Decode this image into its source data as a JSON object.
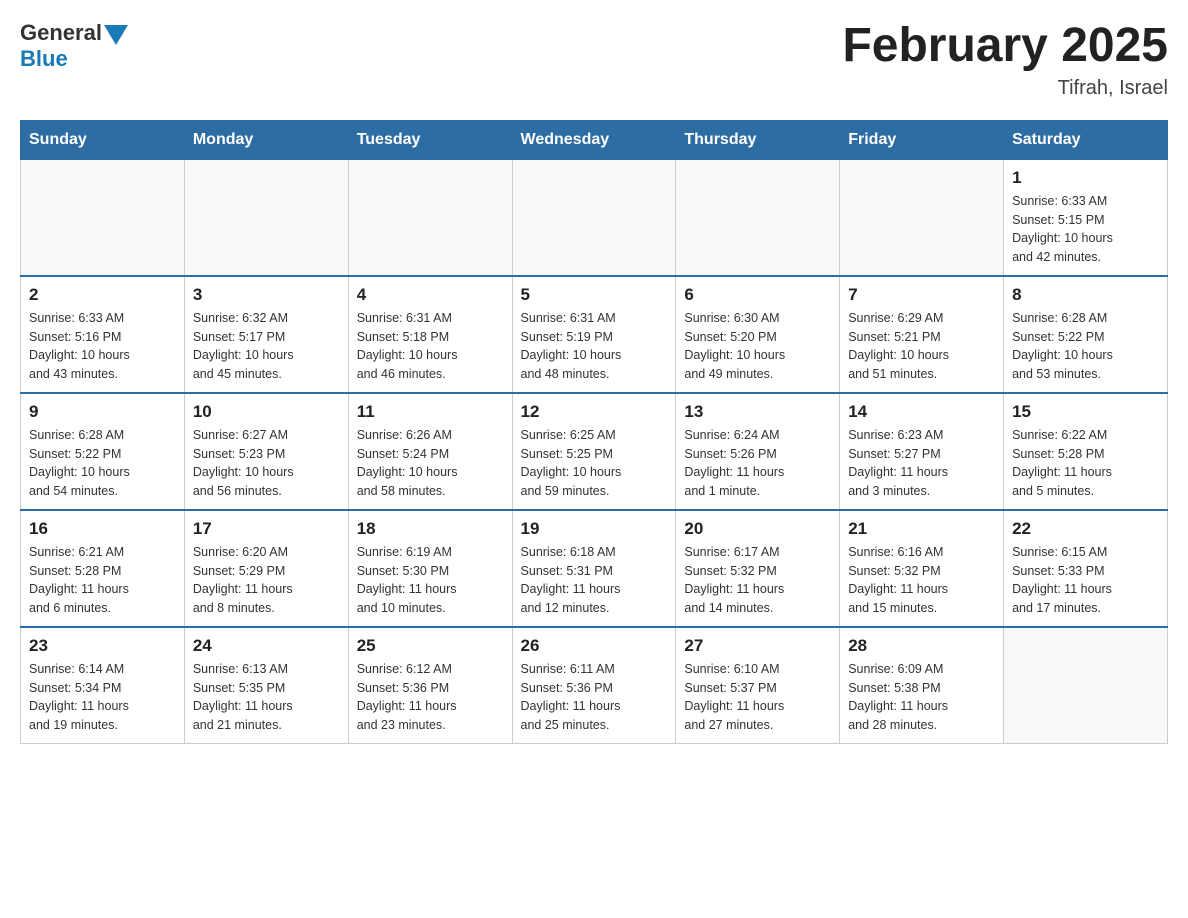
{
  "header": {
    "logo_general": "General",
    "logo_blue": "Blue",
    "title": "February 2025",
    "subtitle": "Tifrah, Israel"
  },
  "weekdays": [
    "Sunday",
    "Monday",
    "Tuesday",
    "Wednesday",
    "Thursday",
    "Friday",
    "Saturday"
  ],
  "weeks": [
    [
      {
        "day": "",
        "info": ""
      },
      {
        "day": "",
        "info": ""
      },
      {
        "day": "",
        "info": ""
      },
      {
        "day": "",
        "info": ""
      },
      {
        "day": "",
        "info": ""
      },
      {
        "day": "",
        "info": ""
      },
      {
        "day": "1",
        "info": "Sunrise: 6:33 AM\nSunset: 5:15 PM\nDaylight: 10 hours\nand 42 minutes."
      }
    ],
    [
      {
        "day": "2",
        "info": "Sunrise: 6:33 AM\nSunset: 5:16 PM\nDaylight: 10 hours\nand 43 minutes."
      },
      {
        "day": "3",
        "info": "Sunrise: 6:32 AM\nSunset: 5:17 PM\nDaylight: 10 hours\nand 45 minutes."
      },
      {
        "day": "4",
        "info": "Sunrise: 6:31 AM\nSunset: 5:18 PM\nDaylight: 10 hours\nand 46 minutes."
      },
      {
        "day": "5",
        "info": "Sunrise: 6:31 AM\nSunset: 5:19 PM\nDaylight: 10 hours\nand 48 minutes."
      },
      {
        "day": "6",
        "info": "Sunrise: 6:30 AM\nSunset: 5:20 PM\nDaylight: 10 hours\nand 49 minutes."
      },
      {
        "day": "7",
        "info": "Sunrise: 6:29 AM\nSunset: 5:21 PM\nDaylight: 10 hours\nand 51 minutes."
      },
      {
        "day": "8",
        "info": "Sunrise: 6:28 AM\nSunset: 5:22 PM\nDaylight: 10 hours\nand 53 minutes."
      }
    ],
    [
      {
        "day": "9",
        "info": "Sunrise: 6:28 AM\nSunset: 5:22 PM\nDaylight: 10 hours\nand 54 minutes."
      },
      {
        "day": "10",
        "info": "Sunrise: 6:27 AM\nSunset: 5:23 PM\nDaylight: 10 hours\nand 56 minutes."
      },
      {
        "day": "11",
        "info": "Sunrise: 6:26 AM\nSunset: 5:24 PM\nDaylight: 10 hours\nand 58 minutes."
      },
      {
        "day": "12",
        "info": "Sunrise: 6:25 AM\nSunset: 5:25 PM\nDaylight: 10 hours\nand 59 minutes."
      },
      {
        "day": "13",
        "info": "Sunrise: 6:24 AM\nSunset: 5:26 PM\nDaylight: 11 hours\nand 1 minute."
      },
      {
        "day": "14",
        "info": "Sunrise: 6:23 AM\nSunset: 5:27 PM\nDaylight: 11 hours\nand 3 minutes."
      },
      {
        "day": "15",
        "info": "Sunrise: 6:22 AM\nSunset: 5:28 PM\nDaylight: 11 hours\nand 5 minutes."
      }
    ],
    [
      {
        "day": "16",
        "info": "Sunrise: 6:21 AM\nSunset: 5:28 PM\nDaylight: 11 hours\nand 6 minutes."
      },
      {
        "day": "17",
        "info": "Sunrise: 6:20 AM\nSunset: 5:29 PM\nDaylight: 11 hours\nand 8 minutes."
      },
      {
        "day": "18",
        "info": "Sunrise: 6:19 AM\nSunset: 5:30 PM\nDaylight: 11 hours\nand 10 minutes."
      },
      {
        "day": "19",
        "info": "Sunrise: 6:18 AM\nSunset: 5:31 PM\nDaylight: 11 hours\nand 12 minutes."
      },
      {
        "day": "20",
        "info": "Sunrise: 6:17 AM\nSunset: 5:32 PM\nDaylight: 11 hours\nand 14 minutes."
      },
      {
        "day": "21",
        "info": "Sunrise: 6:16 AM\nSunset: 5:32 PM\nDaylight: 11 hours\nand 15 minutes."
      },
      {
        "day": "22",
        "info": "Sunrise: 6:15 AM\nSunset: 5:33 PM\nDaylight: 11 hours\nand 17 minutes."
      }
    ],
    [
      {
        "day": "23",
        "info": "Sunrise: 6:14 AM\nSunset: 5:34 PM\nDaylight: 11 hours\nand 19 minutes."
      },
      {
        "day": "24",
        "info": "Sunrise: 6:13 AM\nSunset: 5:35 PM\nDaylight: 11 hours\nand 21 minutes."
      },
      {
        "day": "25",
        "info": "Sunrise: 6:12 AM\nSunset: 5:36 PM\nDaylight: 11 hours\nand 23 minutes."
      },
      {
        "day": "26",
        "info": "Sunrise: 6:11 AM\nSunset: 5:36 PM\nDaylight: 11 hours\nand 25 minutes."
      },
      {
        "day": "27",
        "info": "Sunrise: 6:10 AM\nSunset: 5:37 PM\nDaylight: 11 hours\nand 27 minutes."
      },
      {
        "day": "28",
        "info": "Sunrise: 6:09 AM\nSunset: 5:38 PM\nDaylight: 11 hours\nand 28 minutes."
      },
      {
        "day": "",
        "info": ""
      }
    ]
  ]
}
